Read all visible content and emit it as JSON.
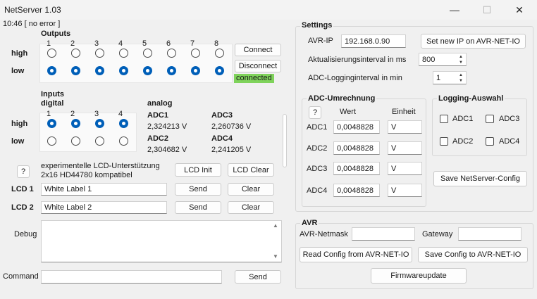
{
  "window": {
    "title": "NetServer 1.03",
    "minimize_glyph": "—",
    "maximize_glyph": "☐",
    "close_glyph": "✕"
  },
  "status": {
    "time_status": "10:46 [ no error ]"
  },
  "outputs": {
    "heading": "Outputs",
    "numbers": [
      "1",
      "2",
      "3",
      "4",
      "5",
      "6",
      "7",
      "8"
    ],
    "high_label": "high",
    "low_label": "low",
    "state": [
      "low",
      "low",
      "low",
      "low",
      "low",
      "low",
      "low",
      "low"
    ]
  },
  "connection": {
    "connect_label": "Connect",
    "disconnect_label": "Disconnect",
    "status_text": "connected",
    "status_color": "#7fd35b"
  },
  "inputs": {
    "heading": "Inputs",
    "subheading": "digital",
    "numbers": [
      "1",
      "2",
      "3",
      "4"
    ],
    "high_label": "high",
    "low_label": "low",
    "state": [
      "high",
      "high",
      "high",
      "high"
    ]
  },
  "analog": {
    "heading": "analog",
    "channels": [
      {
        "label": "ADC1",
        "value": "2,324213 V"
      },
      {
        "label": "ADC3",
        "value": "2,260736 V"
      },
      {
        "label": "ADC2",
        "value": "2,304682 V"
      },
      {
        "label": "ADC4",
        "value": "2,241205 V"
      }
    ]
  },
  "lcd": {
    "help_label": "?",
    "info_line1": "experimentelle LCD-Unterstützung",
    "info_line2": "2x16 HD44780 kompatibel",
    "init_label": "LCD Init",
    "clear_all_label": "LCD Clear",
    "rows": [
      {
        "label": "LCD 1",
        "value": "White Label 1",
        "send_label": "Send",
        "clear_label": "Clear"
      },
      {
        "label": "LCD 2",
        "value": "White Label 2",
        "send_label": "Send",
        "clear_label": "Clear"
      }
    ]
  },
  "debug": {
    "label": "Debug",
    "value": ""
  },
  "command": {
    "label": "Command",
    "value": "",
    "send_label": "Send"
  },
  "settings": {
    "heading": "Settings",
    "avr_ip_label": "AVR-IP",
    "avr_ip_value": "192.168.0.90",
    "set_ip_label": "Set new IP on AVR-NET-IO",
    "update_interval_label": "Aktualisierungsinterval in ms",
    "update_interval_value": "800",
    "adc_log_interval_label": "ADC-Logginginterval in min",
    "adc_log_interval_value": "1"
  },
  "adc_conversion": {
    "heading": "ADC-Umrechnung",
    "help_label": "?",
    "col_value": "Wert",
    "col_unit": "Einheit",
    "rows": [
      {
        "label": "ADC1",
        "value": "0,0048828",
        "unit": "V"
      },
      {
        "label": "ADC2",
        "value": "0,0048828",
        "unit": "V"
      },
      {
        "label": "ADC3",
        "value": "0,0048828",
        "unit": "V"
      },
      {
        "label": "ADC4",
        "value": "0,0048828",
        "unit": "V"
      }
    ]
  },
  "logging": {
    "heading": "Logging-Auswahl",
    "items": [
      {
        "label": "ADC1",
        "checked": false
      },
      {
        "label": "ADC3",
        "checked": false
      },
      {
        "label": "ADC2",
        "checked": false
      },
      {
        "label": "ADC4",
        "checked": false
      }
    ],
    "save_label": "Save NetServer-Config"
  },
  "avr": {
    "heading": "AVR",
    "netmask_label": "AVR-Netmask",
    "netmask_value": "",
    "gateway_label": "Gateway",
    "gateway_value": "",
    "read_label": "Read Config from AVR-NET-IO",
    "save_label": "Save Config to AVR-NET-IO",
    "firmware_label": "Firmwareupdate"
  }
}
